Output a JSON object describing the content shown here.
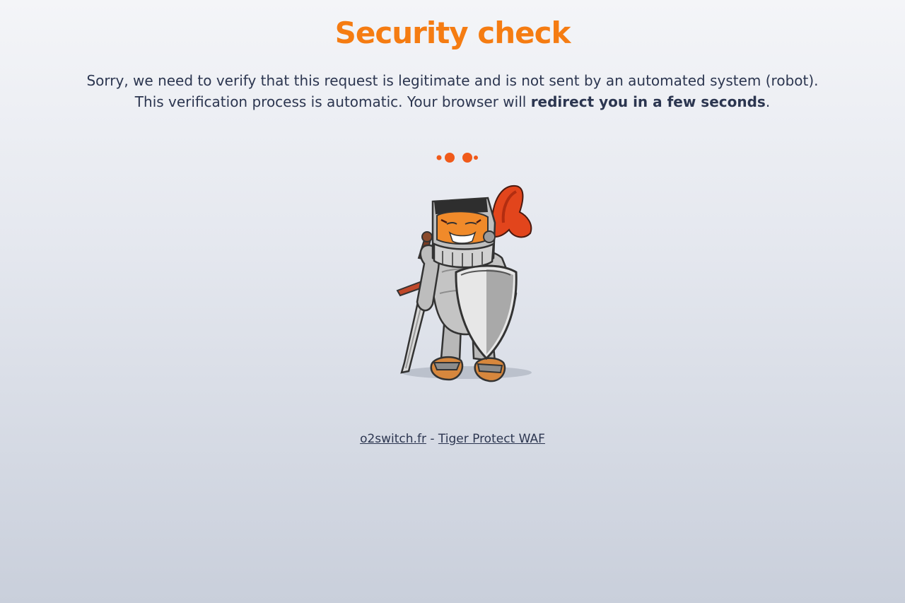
{
  "title": "Security check",
  "message": {
    "line1": "Sorry, we need to verify that this request is legitimate and is not sent by an automated system (robot).",
    "line2_prefix": "This verification process is automatic. Your browser will ",
    "line2_bold": "redirect you in a few seconds",
    "line2_suffix": "."
  },
  "illustration": {
    "icon": "tiger-knight-mascot-icon",
    "loader_icon": "loading-dots-icon"
  },
  "footer": {
    "link1": "o2switch.fr",
    "separator": " - ",
    "link2": "Tiger Protect WAF"
  },
  "colors": {
    "accent": "#f57c12",
    "text": "#2c3650",
    "loader": "#f05a1a"
  }
}
